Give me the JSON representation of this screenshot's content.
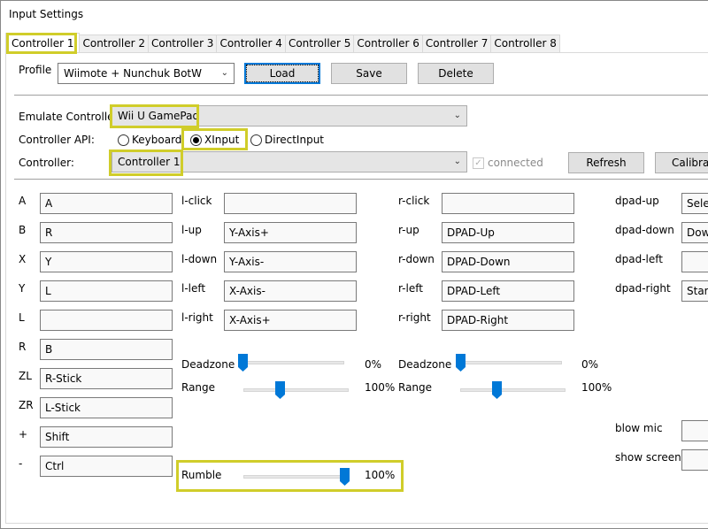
{
  "window": {
    "title": "Input Settings"
  },
  "tabs": [
    "Controller 1",
    "Controller 2",
    "Controller 3",
    "Controller 4",
    "Controller 5",
    "Controller 6",
    "Controller 7",
    "Controller 8"
  ],
  "active_tab": "Controller 1",
  "profile": {
    "label": "Profile",
    "value": "Wiimote + Nunchuk BotW",
    "load_label": "Load",
    "save_label": "Save",
    "delete_label": "Delete"
  },
  "emulate": {
    "label": "Emulate Controller:",
    "value": "Wii U GamePad"
  },
  "api": {
    "label": "Controller API:",
    "options": [
      "Keyboard",
      "XInput",
      "DirectInput"
    ],
    "selected": "XInput"
  },
  "controller": {
    "label": "Controller:",
    "value": "Controller 1",
    "connected_label": "connected",
    "connected": true,
    "refresh_label": "Refresh",
    "calibrate_label": "Calibrat"
  },
  "buttons": [
    {
      "label": "A",
      "value": "A"
    },
    {
      "label": "B",
      "value": "R"
    },
    {
      "label": "X",
      "value": "Y"
    },
    {
      "label": "Y",
      "value": "L"
    },
    {
      "label": "L",
      "value": ""
    },
    {
      "label": "R",
      "value": "B"
    },
    {
      "label": "ZL",
      "value": "R-Stick"
    },
    {
      "label": "ZR",
      "value": "L-Stick"
    },
    {
      "label": "+",
      "value": "Shift"
    },
    {
      "label": "-",
      "value": "Ctrl"
    }
  ],
  "left_stick": [
    {
      "label": "l-click",
      "value": ""
    },
    {
      "label": "l-up",
      "value": "Y-Axis+"
    },
    {
      "label": "l-down",
      "value": "Y-Axis-"
    },
    {
      "label": "l-left",
      "value": "X-Axis-"
    },
    {
      "label": "l-right",
      "value": "X-Axis+"
    }
  ],
  "right_stick": [
    {
      "label": "r-click",
      "value": ""
    },
    {
      "label": "r-up",
      "value": "DPAD-Up"
    },
    {
      "label": "r-down",
      "value": "DPAD-Down"
    },
    {
      "label": "r-left",
      "value": "DPAD-Left"
    },
    {
      "label": "r-right",
      "value": "DPAD-Right"
    }
  ],
  "dpad": [
    {
      "label": "dpad-up",
      "value": "Selec"
    },
    {
      "label": "dpad-down",
      "value": "Dow"
    },
    {
      "label": "dpad-left",
      "value": ""
    },
    {
      "label": "dpad-right",
      "value": "Start"
    }
  ],
  "left_sliders": {
    "deadzone_label": "Deadzone",
    "deadzone_value": "0%",
    "deadzone_pos": 0.0,
    "range_label": "Range",
    "range_value": "100%",
    "range_pos": 0.33
  },
  "right_sliders": {
    "deadzone_label": "Deadzone",
    "deadzone_value": "0%",
    "deadzone_pos": 0.0,
    "range_label": "Range",
    "range_value": "100%",
    "range_pos": 0.33
  },
  "rumble": {
    "label": "Rumble",
    "value": "100%",
    "pos": 1.0
  },
  "extras": [
    {
      "label": "blow mic",
      "value": ""
    },
    {
      "label": "show screen",
      "value": ""
    }
  ],
  "colors": {
    "highlight": "#d0cd2a",
    "accent": "#0078d7"
  }
}
